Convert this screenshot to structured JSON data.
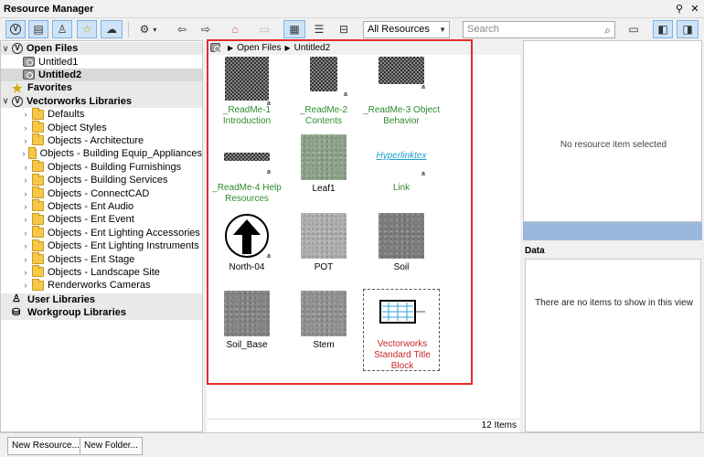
{
  "window": {
    "title": "Resource Manager",
    "pin_label": "ꟼ",
    "dock_label": "♯",
    "close_label": "✕"
  },
  "toolbar": {
    "filter_value": "All Resources",
    "search_placeholder": "Search"
  },
  "tree": {
    "open_files": "Open Files",
    "files": [
      "Untitled1",
      "Untitled2"
    ],
    "favorites": "Favorites",
    "vw_libraries": "Vectorworks Libraries",
    "folders": [
      "Defaults",
      "Object Styles",
      "Objects - Architecture",
      "Objects - Building Equip_Appliances",
      "Objects - Building Furnishings",
      "Objects - Building Services",
      "Objects - ConnectCAD",
      "Objects - Ent Audio",
      "Objects - Ent Event",
      "Objects - Ent Lighting Accessories",
      "Objects - Ent Lighting Instruments",
      "Objects - Ent Stage",
      "Objects - Landscape Site",
      "Renderworks Cameras"
    ],
    "user_libraries": "User Libraries",
    "workgroup_libraries": "Workgroup Libraries"
  },
  "breadcrumb": {
    "level1": "Open Files",
    "level2": "Untitled2"
  },
  "resources": [
    {
      "name": "_ReadMe-1\nIntroduction",
      "l1": "_ReadMe-1",
      "l2": "Introduction",
      "kind": "text"
    },
    {
      "name": "_ReadMe-2 Contents",
      "l1": "_ReadMe-2",
      "l2": "Contents",
      "kind": "text"
    },
    {
      "name": "_ReadMe-3 Object Behavior",
      "l1": "_ReadMe-3 Object",
      "l2": "Behavior",
      "kind": "text"
    },
    {
      "name": "_ReadMe-4 Help Resources",
      "l1": "_ReadMe-4 Help",
      "l2": "Resources",
      "kind": "text"
    },
    {
      "name": "Leaf1",
      "l1": "Leaf1",
      "l2": "",
      "kind": "texture"
    },
    {
      "name": "Link",
      "l1": "Link",
      "l2": "",
      "kind": "hyperlink",
      "thumb_text": "Hyperlinktex"
    },
    {
      "name": "North-04",
      "l1": "North-04",
      "l2": "",
      "kind": "symbol"
    },
    {
      "name": "POT",
      "l1": "POT",
      "l2": "",
      "kind": "texture"
    },
    {
      "name": "Soil",
      "l1": "Soil",
      "l2": "",
      "kind": "texture"
    },
    {
      "name": "Soil_Base",
      "l1": "Soil_Base",
      "l2": "",
      "kind": "texture"
    },
    {
      "name": "Stem",
      "l1": "Stem",
      "l2": "",
      "kind": "texture"
    },
    {
      "name": "Vectorworks Standard Title Block",
      "l1": "Vectorworks",
      "l2": "Standard Title",
      "l3": "Block",
      "kind": "titleblock"
    }
  ],
  "status": {
    "item_count": "12 Items"
  },
  "preview": {
    "empty_message": "No resource item selected"
  },
  "data_panel": {
    "header": "Data",
    "empty_message": "There are no items to show in this view"
  },
  "buttons": {
    "new_resource": "New Resource...",
    "new_folder": "New Folder..."
  },
  "colors": {
    "highlight": "#e52b2b",
    "accent": "#9ab7dc",
    "text_resource": "#2e8b2e",
    "titleblock": "#c62828"
  }
}
